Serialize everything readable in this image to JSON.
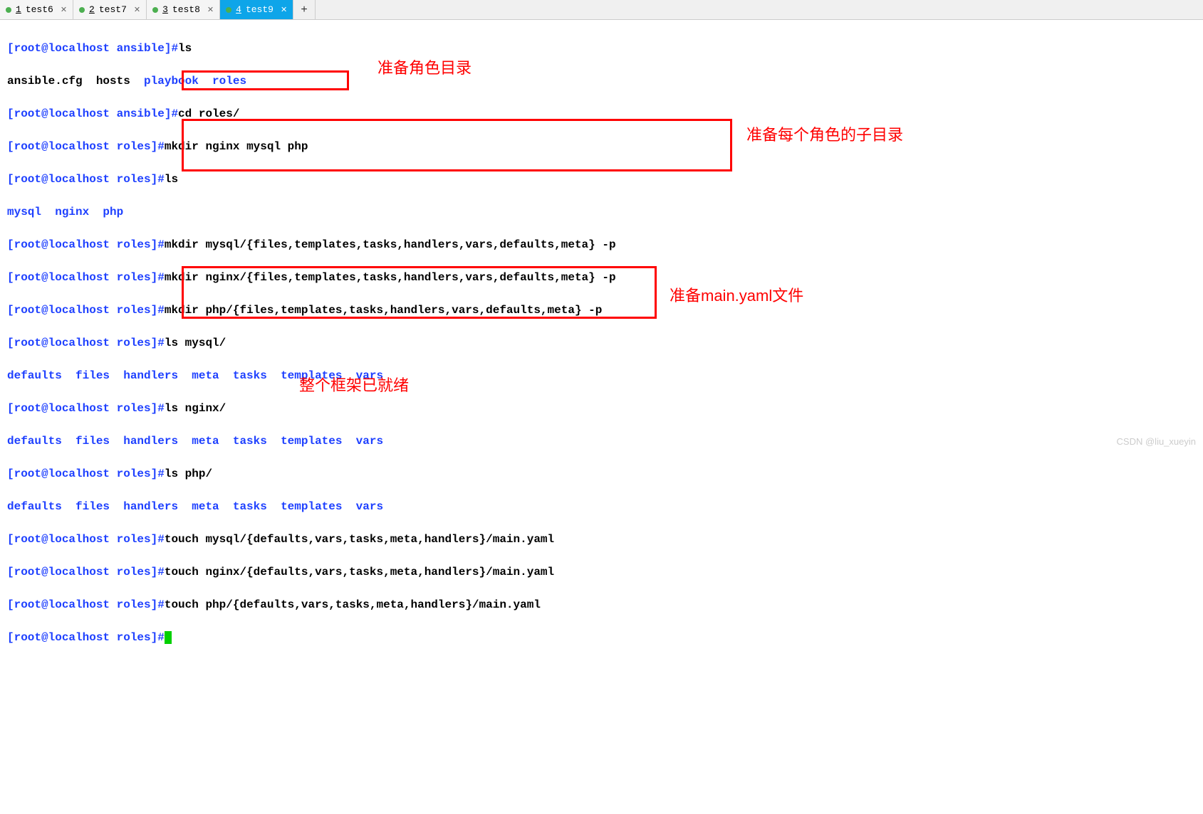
{
  "tabs": [
    {
      "num": "1",
      "label": "test6"
    },
    {
      "num": "2",
      "label": "test7"
    },
    {
      "num": "3",
      "label": "test8"
    },
    {
      "num": "4",
      "label": "test9"
    }
  ],
  "tab_add": "+",
  "prompts": {
    "ansible": "[root@localhost ansible]#",
    "roles": "[root@localhost roles]#"
  },
  "cmds": {
    "ls": "ls",
    "cd_roles": "cd roles/",
    "mkdir_roles": "mkdir nginx mysql php",
    "mkdir_mysql": "mkdir mysql/{files,templates,tasks,handlers,vars,defaults,meta} -p",
    "mkdir_nginx": "mkdir nginx/{files,templates,tasks,handlers,vars,defaults,meta} -p",
    "mkdir_php": "mkdir php/{files,templates,tasks,handlers,vars,defaults,meta} -p",
    "ls_mysql": "ls mysql/",
    "ls_nginx": "ls nginx/",
    "ls_php": "ls php/",
    "touch_mysql": "touch mysql/{defaults,vars,tasks,meta,handlers}/main.yaml",
    "touch_nginx": "touch nginx/{defaults,vars,tasks,meta,handlers}/main.yaml",
    "touch_php": "touch php/{defaults,vars,tasks,meta,handlers}/main.yaml"
  },
  "outputs": {
    "ansible_ls_plain": "ansible.cfg  hosts  ",
    "ansible_ls_dirs": "playbook  roles",
    "roles_ls": "mysql  nginx  php",
    "subdirs": "defaults  files  handlers  meta  tasks  templates  vars"
  },
  "annotations": {
    "a1": "准备角色目录",
    "a2": "准备每个角色的子目录",
    "a3": "准备main.yaml文件",
    "a4": "整个框架已就绪"
  },
  "watermark": "CSDN @liu_xueyin"
}
